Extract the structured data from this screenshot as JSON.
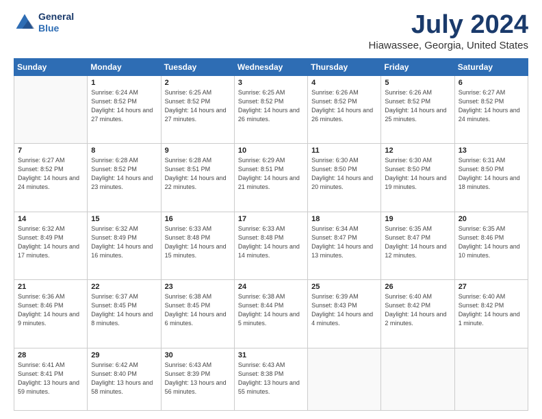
{
  "logo": {
    "line1": "General",
    "line2": "Blue"
  },
  "title": "July 2024",
  "subtitle": "Hiawassee, Georgia, United States",
  "days_of_week": [
    "Sunday",
    "Monday",
    "Tuesday",
    "Wednesday",
    "Thursday",
    "Friday",
    "Saturday"
  ],
  "weeks": [
    [
      {
        "day": "",
        "sunrise": "",
        "sunset": "",
        "daylight": ""
      },
      {
        "day": "1",
        "sunrise": "6:24 AM",
        "sunset": "8:52 PM",
        "daylight": "14 hours and 27 minutes."
      },
      {
        "day": "2",
        "sunrise": "6:25 AM",
        "sunset": "8:52 PM",
        "daylight": "14 hours and 27 minutes."
      },
      {
        "day": "3",
        "sunrise": "6:25 AM",
        "sunset": "8:52 PM",
        "daylight": "14 hours and 26 minutes."
      },
      {
        "day": "4",
        "sunrise": "6:26 AM",
        "sunset": "8:52 PM",
        "daylight": "14 hours and 26 minutes."
      },
      {
        "day": "5",
        "sunrise": "6:26 AM",
        "sunset": "8:52 PM",
        "daylight": "14 hours and 25 minutes."
      },
      {
        "day": "6",
        "sunrise": "6:27 AM",
        "sunset": "8:52 PM",
        "daylight": "14 hours and 24 minutes."
      }
    ],
    [
      {
        "day": "7",
        "sunrise": "6:27 AM",
        "sunset": "8:52 PM",
        "daylight": "14 hours and 24 minutes."
      },
      {
        "day": "8",
        "sunrise": "6:28 AM",
        "sunset": "8:52 PM",
        "daylight": "14 hours and 23 minutes."
      },
      {
        "day": "9",
        "sunrise": "6:28 AM",
        "sunset": "8:51 PM",
        "daylight": "14 hours and 22 minutes."
      },
      {
        "day": "10",
        "sunrise": "6:29 AM",
        "sunset": "8:51 PM",
        "daylight": "14 hours and 21 minutes."
      },
      {
        "day": "11",
        "sunrise": "6:30 AM",
        "sunset": "8:50 PM",
        "daylight": "14 hours and 20 minutes."
      },
      {
        "day": "12",
        "sunrise": "6:30 AM",
        "sunset": "8:50 PM",
        "daylight": "14 hours and 19 minutes."
      },
      {
        "day": "13",
        "sunrise": "6:31 AM",
        "sunset": "8:50 PM",
        "daylight": "14 hours and 18 minutes."
      }
    ],
    [
      {
        "day": "14",
        "sunrise": "6:32 AM",
        "sunset": "8:49 PM",
        "daylight": "14 hours and 17 minutes."
      },
      {
        "day": "15",
        "sunrise": "6:32 AM",
        "sunset": "8:49 PM",
        "daylight": "14 hours and 16 minutes."
      },
      {
        "day": "16",
        "sunrise": "6:33 AM",
        "sunset": "8:48 PM",
        "daylight": "14 hours and 15 minutes."
      },
      {
        "day": "17",
        "sunrise": "6:33 AM",
        "sunset": "8:48 PM",
        "daylight": "14 hours and 14 minutes."
      },
      {
        "day": "18",
        "sunrise": "6:34 AM",
        "sunset": "8:47 PM",
        "daylight": "14 hours and 13 minutes."
      },
      {
        "day": "19",
        "sunrise": "6:35 AM",
        "sunset": "8:47 PM",
        "daylight": "14 hours and 12 minutes."
      },
      {
        "day": "20",
        "sunrise": "6:35 AM",
        "sunset": "8:46 PM",
        "daylight": "14 hours and 10 minutes."
      }
    ],
    [
      {
        "day": "21",
        "sunrise": "6:36 AM",
        "sunset": "8:46 PM",
        "daylight": "14 hours and 9 minutes."
      },
      {
        "day": "22",
        "sunrise": "6:37 AM",
        "sunset": "8:45 PM",
        "daylight": "14 hours and 8 minutes."
      },
      {
        "day": "23",
        "sunrise": "6:38 AM",
        "sunset": "8:45 PM",
        "daylight": "14 hours and 6 minutes."
      },
      {
        "day": "24",
        "sunrise": "6:38 AM",
        "sunset": "8:44 PM",
        "daylight": "14 hours and 5 minutes."
      },
      {
        "day": "25",
        "sunrise": "6:39 AM",
        "sunset": "8:43 PM",
        "daylight": "14 hours and 4 minutes."
      },
      {
        "day": "26",
        "sunrise": "6:40 AM",
        "sunset": "8:42 PM",
        "daylight": "14 hours and 2 minutes."
      },
      {
        "day": "27",
        "sunrise": "6:40 AM",
        "sunset": "8:42 PM",
        "daylight": "14 hours and 1 minute."
      }
    ],
    [
      {
        "day": "28",
        "sunrise": "6:41 AM",
        "sunset": "8:41 PM",
        "daylight": "13 hours and 59 minutes."
      },
      {
        "day": "29",
        "sunrise": "6:42 AM",
        "sunset": "8:40 PM",
        "daylight": "13 hours and 58 minutes."
      },
      {
        "day": "30",
        "sunrise": "6:43 AM",
        "sunset": "8:39 PM",
        "daylight": "13 hours and 56 minutes."
      },
      {
        "day": "31",
        "sunrise": "6:43 AM",
        "sunset": "8:38 PM",
        "daylight": "13 hours and 55 minutes."
      },
      {
        "day": "",
        "sunrise": "",
        "sunset": "",
        "daylight": ""
      },
      {
        "day": "",
        "sunrise": "",
        "sunset": "",
        "daylight": ""
      },
      {
        "day": "",
        "sunrise": "",
        "sunset": "",
        "daylight": ""
      }
    ]
  ]
}
